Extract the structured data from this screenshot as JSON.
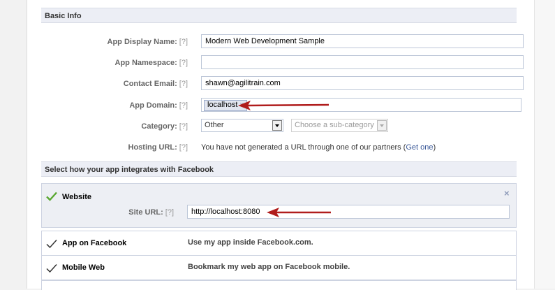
{
  "basic_info": {
    "header": "Basic Info",
    "help_marker": "[?]",
    "app_display_name": {
      "label": "App Display Name:",
      "value": "Modern Web Development Sample"
    },
    "app_namespace": {
      "label": "App Namespace:",
      "value": ""
    },
    "contact_email": {
      "label": "Contact Email:",
      "value": "shawn@agilitrain.com"
    },
    "app_domain": {
      "label": "App Domain:",
      "token": "localhost",
      "token_remove": "×"
    },
    "category": {
      "label": "Category:",
      "selected": "Other",
      "sub_placeholder": "Choose a sub-category"
    },
    "hosting_url": {
      "label": "Hosting URL:",
      "text": "You have not generated a URL through one of our partners (",
      "link": "Get one",
      "text_end": ")"
    }
  },
  "integrations": {
    "header": "Select how your app integrates with Facebook",
    "website": {
      "title": "Website",
      "close": "×",
      "site_url_label": "Site URL:",
      "site_url_value": "http://localhost:8080"
    },
    "items": [
      {
        "title": "App on Facebook",
        "description": "Use my app inside Facebook.com."
      },
      {
        "title": "Mobile Web",
        "description": "Bookmark my web app on Facebook mobile."
      }
    ]
  },
  "colors": {
    "accent": "#3b5998",
    "arrow": "#b01c1c",
    "check": "#5aa832"
  }
}
